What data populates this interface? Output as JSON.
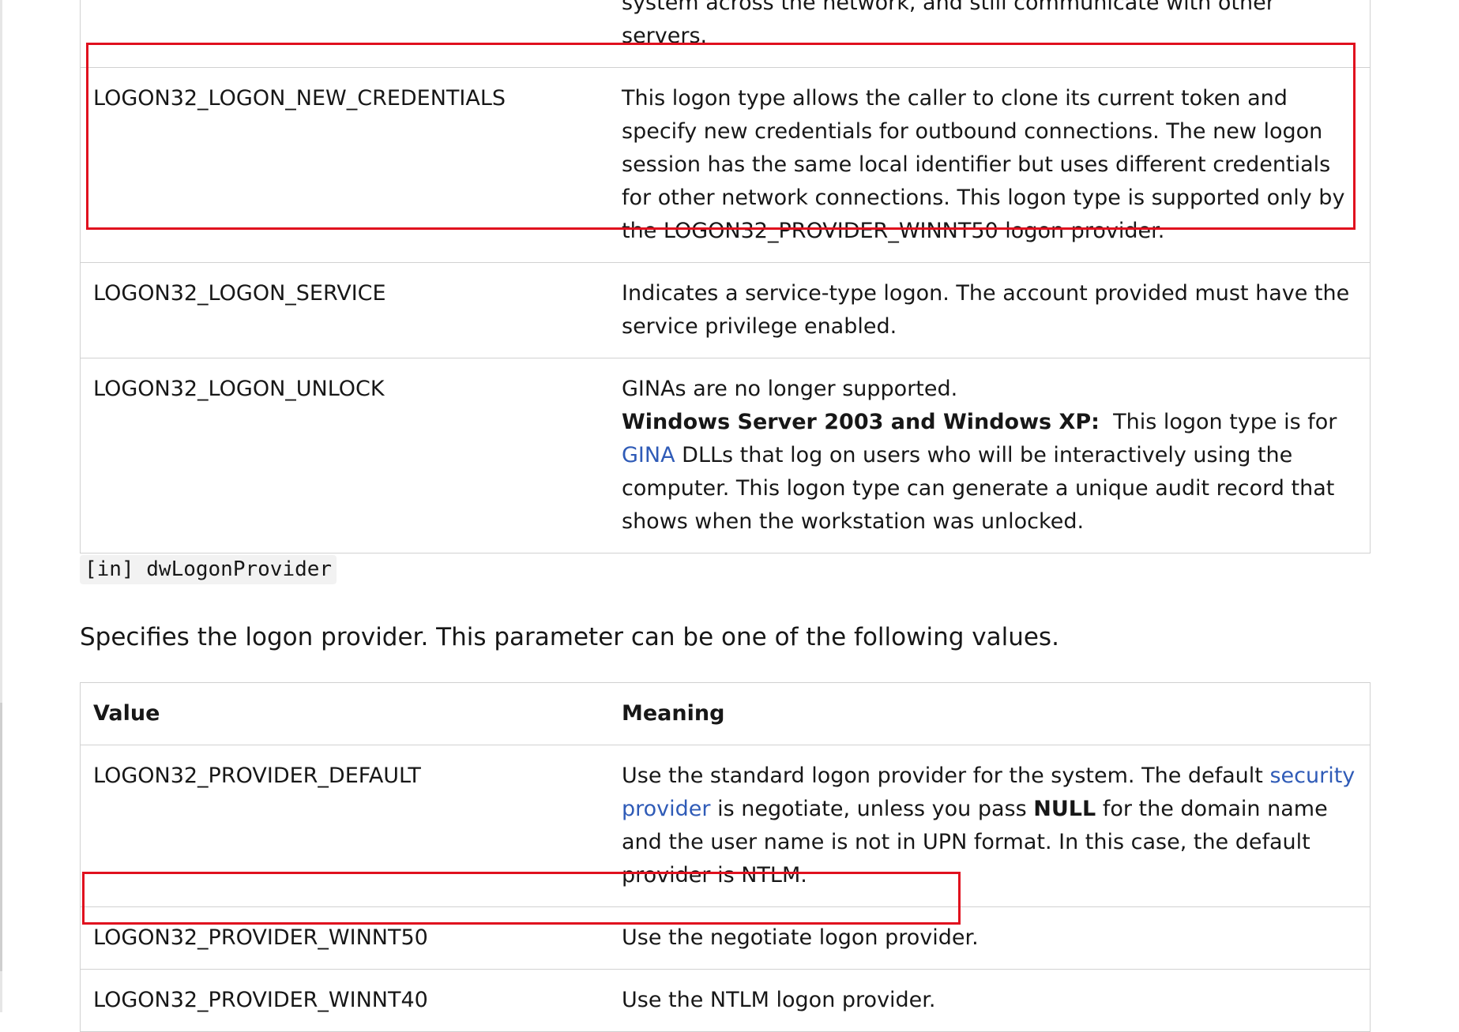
{
  "logon_type_table": {
    "rows": [
      {
        "value": "",
        "meaning": "system across the network, and still communicate with other servers."
      },
      {
        "value": "LOGON32_LOGON_NEW_CREDENTIALS",
        "meaning": "This logon type allows the caller to clone its current token and specify new credentials for outbound connections. The new logon session has the same local identifier but uses different credentials for other network connections. This logon type is supported only by the LOGON32_PROVIDER_WINNT50 logon provider."
      },
      {
        "value": "LOGON32_LOGON_SERVICE",
        "meaning": "Indicates a service-type logon. The account provided must have the service privilege enabled."
      },
      {
        "value": "LOGON32_LOGON_UNLOCK",
        "meaning_line1": "GINAs are no longer supported.",
        "meaning_bold": "Windows Server 2003 and Windows XP:",
        "meaning_pre_link": "This logon type is for",
        "meaning_link": "GINA",
        "meaning_post_link": "DLLs that log on users who will be interactively using the computer. This logon type can generate a unique audit record that shows when the workstation was unlocked."
      }
    ]
  },
  "parameter": {
    "code": "[in] dwLogonProvider",
    "description": "Specifies the logon provider. This parameter can be one of the following values."
  },
  "provider_table": {
    "header_value": "Value",
    "header_meaning": "Meaning",
    "rows": [
      {
        "value": "LOGON32_PROVIDER_DEFAULT",
        "meaning_pre_link": "Use the standard logon provider for the system. The default",
        "meaning_link": "security provider",
        "meaning_mid": "is negotiate, unless you pass",
        "meaning_bold": "NULL",
        "meaning_post": "for the domain name and the user name is not in UPN format. In this case, the default provider is NTLM."
      },
      {
        "value": "LOGON32_PROVIDER_WINNT50",
        "meaning": "Use the negotiate logon provider."
      },
      {
        "value": "LOGON32_PROVIDER_WINNT40",
        "meaning": "Use the NTLM logon provider."
      }
    ]
  },
  "colors": {
    "highlight": "#e0101e",
    "link": "#2f5bb7",
    "border": "#d1d1d1"
  }
}
